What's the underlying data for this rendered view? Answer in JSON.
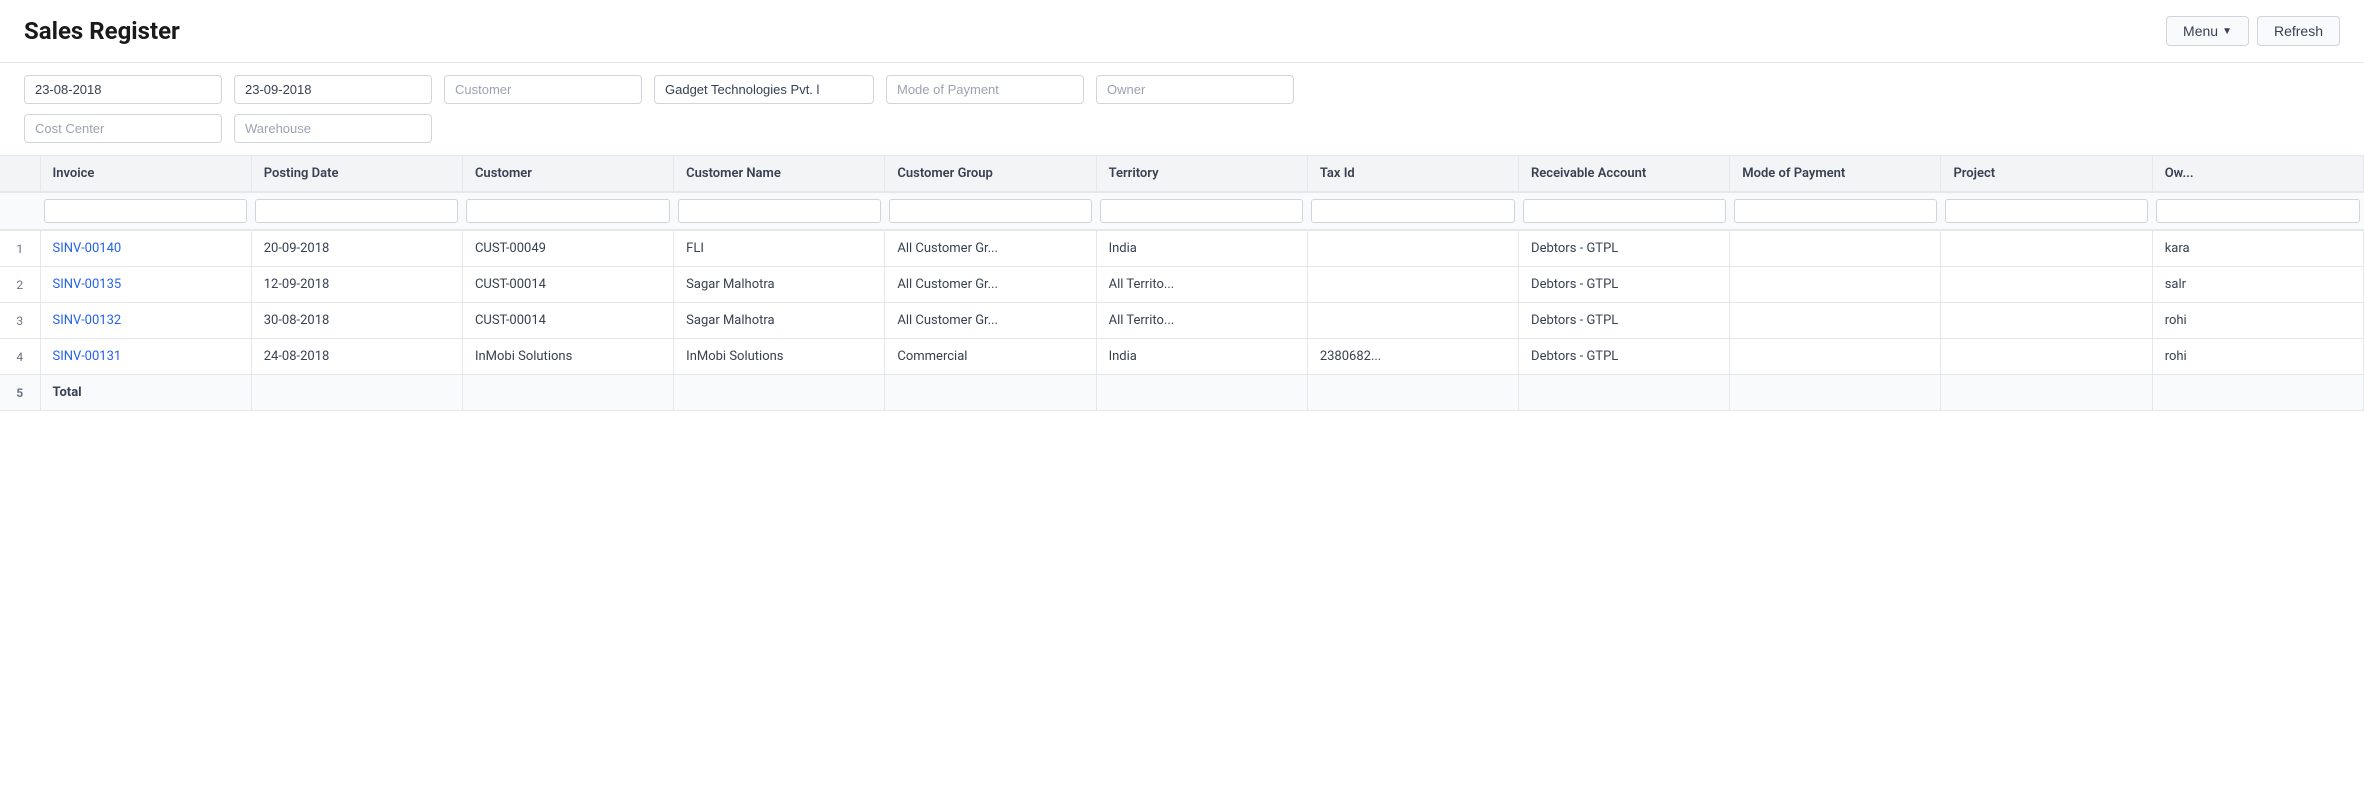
{
  "header": {
    "title": "Sales Register",
    "menu_label": "Menu",
    "refresh_label": "Refresh"
  },
  "filters": {
    "date_from": "23-08-2018",
    "date_to": "23-09-2018",
    "customer_placeholder": "Customer",
    "company_value": "Gadget Technologies Pvt. l",
    "mode_of_payment_placeholder": "Mode of Payment",
    "owner_placeholder": "Owner",
    "cost_center_placeholder": "Cost Center",
    "warehouse_placeholder": "Warehouse"
  },
  "table": {
    "columns": [
      {
        "key": "num",
        "label": ""
      },
      {
        "key": "invoice",
        "label": "Invoice"
      },
      {
        "key": "posting_date",
        "label": "Posting Date"
      },
      {
        "key": "customer",
        "label": "Customer"
      },
      {
        "key": "customer_name",
        "label": "Customer Name"
      },
      {
        "key": "customer_group",
        "label": "Customer Group"
      },
      {
        "key": "territory",
        "label": "Territory"
      },
      {
        "key": "tax_id",
        "label": "Tax Id"
      },
      {
        "key": "receivable_account",
        "label": "Receivable Account"
      },
      {
        "key": "mode_of_payment",
        "label": "Mode of Payment"
      },
      {
        "key": "project",
        "label": "Project"
      },
      {
        "key": "owner",
        "label": "Ow..."
      }
    ],
    "rows": [
      {
        "num": "1",
        "invoice": "SINV-00140",
        "posting_date": "20-09-2018",
        "customer": "CUST-00049",
        "customer_name": "FLI",
        "customer_group": "All Customer Gr...",
        "territory": "India",
        "tax_id": "",
        "receivable_account": "Debtors - GTPL",
        "mode_of_payment": "",
        "project": "",
        "owner": "kara"
      },
      {
        "num": "2",
        "invoice": "SINV-00135",
        "posting_date": "12-09-2018",
        "customer": "CUST-00014",
        "customer_name": "Sagar Malhotra",
        "customer_group": "All Customer Gr...",
        "territory": "All Territo...",
        "tax_id": "",
        "receivable_account": "Debtors - GTPL",
        "mode_of_payment": "",
        "project": "",
        "owner": "salr"
      },
      {
        "num": "3",
        "invoice": "SINV-00132",
        "posting_date": "30-08-2018",
        "customer": "CUST-00014",
        "customer_name": "Sagar Malhotra",
        "customer_group": "All Customer Gr...",
        "territory": "All Territo...",
        "tax_id": "",
        "receivable_account": "Debtors - GTPL",
        "mode_of_payment": "",
        "project": "",
        "owner": "rohi"
      },
      {
        "num": "4",
        "invoice": "SINV-00131",
        "posting_date": "24-08-2018",
        "customer": "InMobi Solutions",
        "customer_name": "InMobi Solutions",
        "customer_group": "Commercial",
        "territory": "India",
        "tax_id": "2380682...",
        "receivable_account": "Debtors - GTPL",
        "mode_of_payment": "",
        "project": "",
        "owner": "rohi"
      }
    ],
    "total_row": {
      "num": "5",
      "label": "Total"
    }
  }
}
